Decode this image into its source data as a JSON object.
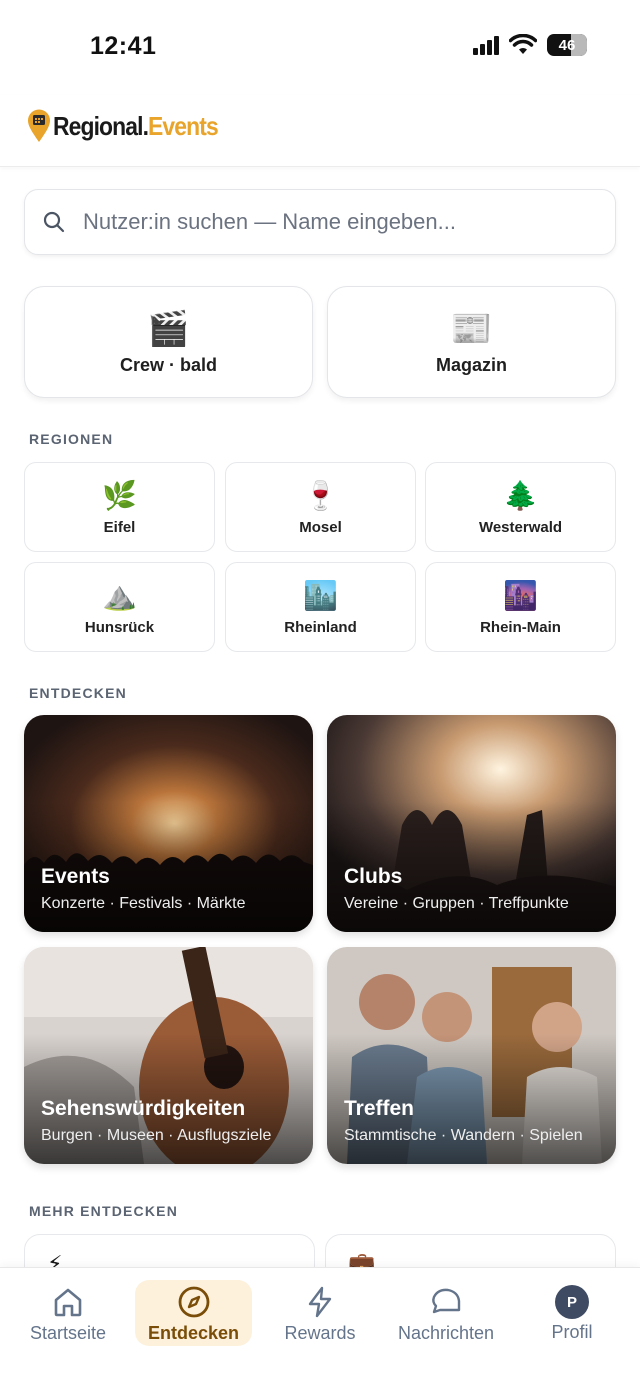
{
  "status_bar": {
    "time": "12:41",
    "battery": "46",
    "icons": [
      "signal-icon",
      "wifi-icon",
      "battery-icon"
    ]
  },
  "header": {
    "logo_part1": "Regional.",
    "logo_part2": "Events",
    "accent_color": "#e8a42b"
  },
  "search": {
    "placeholder": "Nutzer:in suchen — Name eingeben..."
  },
  "quick_actions": [
    {
      "emoji": "🎬",
      "label": "Crew · bald",
      "icon": "clapperboard-icon"
    },
    {
      "emoji": "📰",
      "label": "Magazin",
      "icon": "newspaper-icon"
    }
  ],
  "regions": {
    "title": "REGIONEN",
    "items": [
      {
        "emoji": "🌿",
        "label": "Eifel"
      },
      {
        "emoji": "🍷",
        "label": "Mosel"
      },
      {
        "emoji": "🌲",
        "label": "Westerwald"
      },
      {
        "emoji": "⛰️",
        "label": "Hunsrück"
      },
      {
        "emoji": "🏙️",
        "label": "Rheinland"
      },
      {
        "emoji": "🌆",
        "label": "Rhein-Main"
      }
    ]
  },
  "discover": {
    "title": "ENTDECKEN",
    "tiles": [
      {
        "title": "Events",
        "subtitle": "Konzerte · Festivals · Märkte"
      },
      {
        "title": "Clubs",
        "subtitle": "Vereine · Gruppen · Treffpunkte"
      },
      {
        "title": "Sehenswürdigkeiten",
        "subtitle": "Burgen · Museen · Ausflugsziele"
      },
      {
        "title": "Treffen",
        "subtitle": "Stammtische · Wandern · Spielen"
      }
    ]
  },
  "more": {
    "title": "MEHR ENTDECKEN"
  },
  "tabbar": {
    "active_color": "#7a4d08",
    "items": [
      {
        "label": "Startseite",
        "icon": "home-icon"
      },
      {
        "label": "Entdecken",
        "icon": "compass-icon",
        "active": true
      },
      {
        "label": "Rewards",
        "icon": "lightning-icon"
      },
      {
        "label": "Nachrichten",
        "icon": "chat-bubble-icon"
      },
      {
        "label": "Profil",
        "icon": "avatar-icon",
        "avatar_letter": "P"
      }
    ]
  }
}
